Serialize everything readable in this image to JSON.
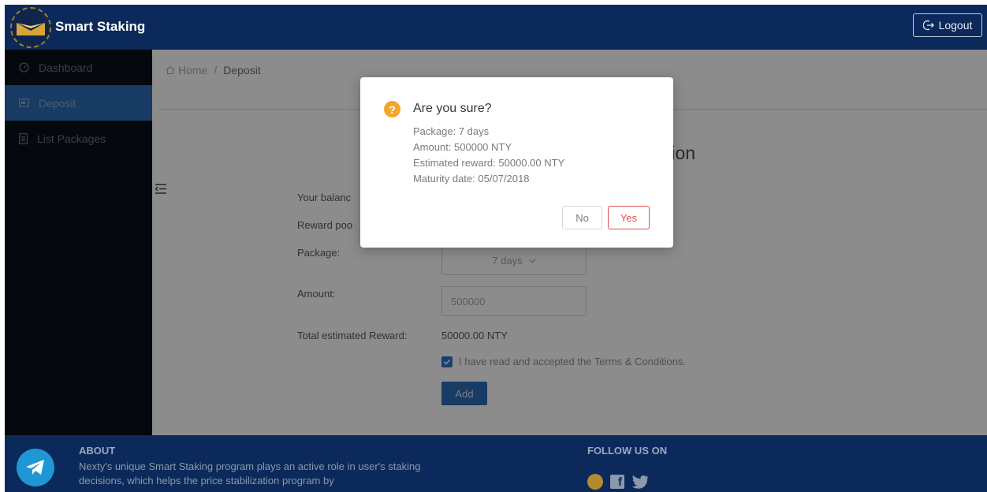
{
  "header": {
    "brand": "Smart Staking",
    "logout_label": "Logout"
  },
  "sidebar": {
    "items": [
      {
        "label": "Dashboard",
        "icon": "dashboard-gauge-icon"
      },
      {
        "label": "Deposit",
        "icon": "wallet-icon",
        "active": true
      },
      {
        "label": "List Packages",
        "icon": "list-icon"
      }
    ]
  },
  "breadcrumb": {
    "home": "Home",
    "separator": "/",
    "current": "Deposit"
  },
  "form": {
    "title_fragment": "tion",
    "balance_label_fragment": "Your balanc",
    "reward_pool_label_fragment": "Reward poo",
    "package_label": "Package:",
    "package_value": "7 days",
    "amount_label": "Amount:",
    "amount_value": "500000",
    "total_reward_label": "Total estimated Reward:",
    "total_reward_value": "50000.00 NTY",
    "terms_label": "I have read and accepted the Terms & Conditions.",
    "add_label": "Add"
  },
  "footer": {
    "about_title": "ABOUT",
    "about_text": "Nexty's unique Smart Staking program plays an active role in user's staking decisions, which helps the price stabilization program by",
    "follow_title": "FOLLOW US ON"
  },
  "modal": {
    "title": "Are you sure?",
    "icon": "?",
    "lines": [
      "Package: 7 days",
      "Amount: 500000 NTY",
      "Estimated reward: 50000.00 NTY",
      "Maturity date: 05/07/2018"
    ],
    "no_label": "No",
    "yes_label": "Yes"
  },
  "colors": {
    "header_bg": "#0b2a5b",
    "sidebar_bg": "#0a0f16",
    "sidebar_active": "#2a6cb3",
    "primary": "#2e6db9",
    "danger": "#e2504d",
    "warning": "#f4a52a"
  }
}
